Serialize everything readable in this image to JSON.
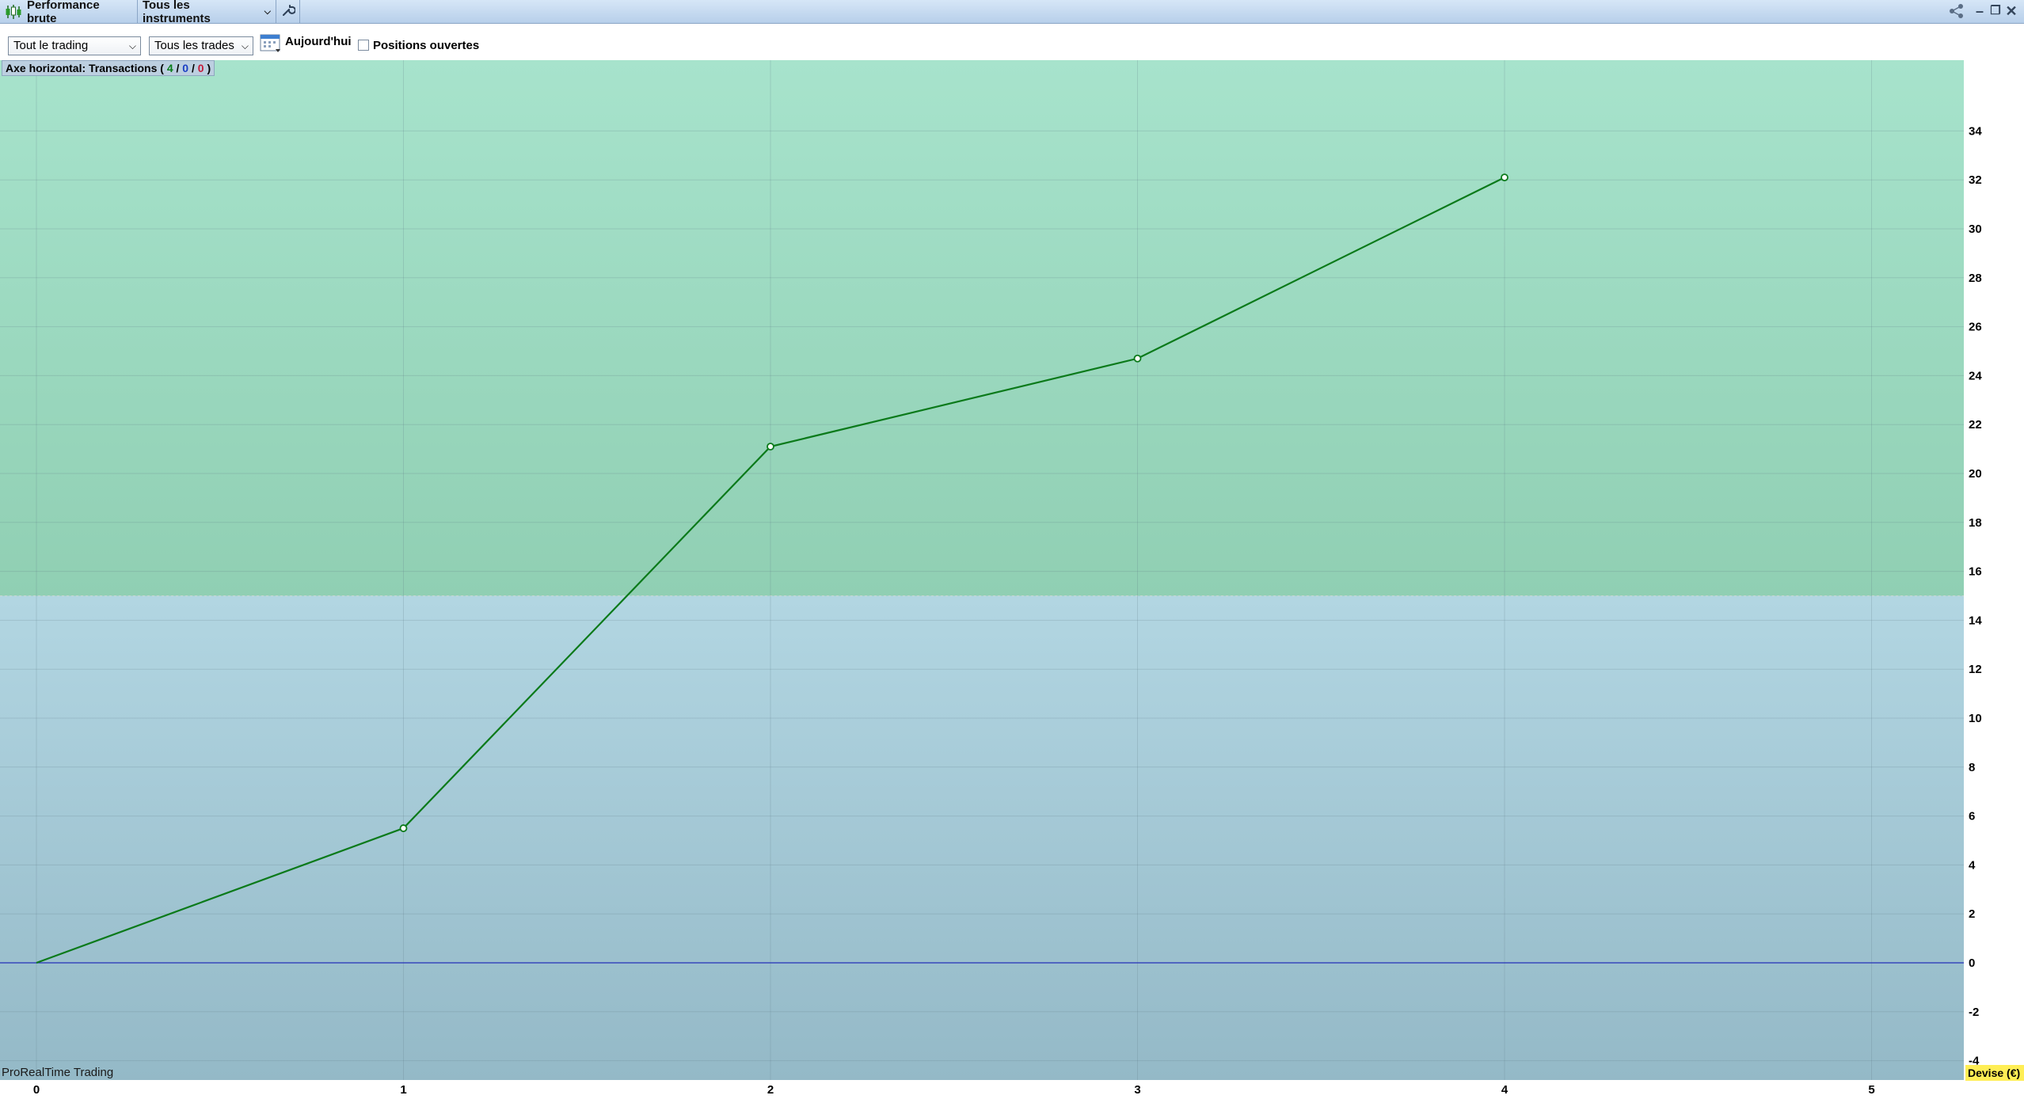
{
  "titlebar": {
    "title": "Performance brute",
    "instruments_label": "Tous les instruments",
    "app_icon": "candlestick-chart-icon",
    "wrench_icon": "wrench-icon",
    "share_icon": "share-icon",
    "minimize_icon": "minimize-icon",
    "restore_icon": "restore-icon",
    "close_icon": "close-icon"
  },
  "toolbar": {
    "trading_select": "Tout le trading",
    "trades_select": "Tous les trades",
    "date_label": "Aujourd'hui",
    "open_positions_label": "Positions ouvertes",
    "open_positions_checked": false,
    "calendar_icon": "calendar-icon"
  },
  "chart_info": {
    "axis_label": "Axe horizontal: Transactions (",
    "count_total": "4",
    "sep1": "/",
    "count_zero": "0",
    "sep2": "/",
    "count_neg": "0",
    "close_paren": ")"
  },
  "footer": {
    "brand": "ProRealTime Trading",
    "currency": "Devise (€)"
  },
  "colors": {
    "positive_zone": "#a5e1c9",
    "negative_zone": "#aed2dd",
    "line": "#0b7a1a",
    "zero_line": "#2330b8",
    "currency_badge": "#ffee55"
  },
  "chart_data": {
    "type": "line",
    "title": "",
    "xlabel": "",
    "ylabel": "",
    "x": [
      0,
      1,
      2,
      3,
      4
    ],
    "series": [
      {
        "values": [
          0,
          5.5,
          21.1,
          24.7,
          32.1
        ]
      }
    ],
    "xlim": [
      0,
      5
    ],
    "ylim": [
      -4,
      36
    ],
    "x_ticks": [
      "0",
      "1",
      "2",
      "3",
      "4",
      "5"
    ],
    "y_ticks": [
      "-4",
      "-2",
      "0",
      "2",
      "4",
      "6",
      "8",
      "10",
      "12",
      "14",
      "16",
      "18",
      "20",
      "22",
      "24",
      "26",
      "28",
      "30",
      "32",
      "34"
    ],
    "grid": true,
    "zone_threshold": 15
  }
}
